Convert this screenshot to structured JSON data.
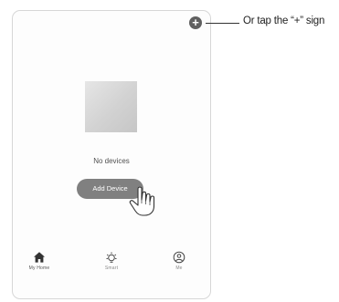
{
  "header": {
    "add_icon_glyph": "+"
  },
  "callout": {
    "text": "Or tap the “+” sign"
  },
  "main": {
    "empty_text": "No devices",
    "add_device_label": "Add Device"
  },
  "tabs": [
    {
      "label": "My Home",
      "icon": "home-icon",
      "active": true
    },
    {
      "label": "Smart",
      "icon": "smart-icon",
      "active": false
    },
    {
      "label": "Me",
      "icon": "profile-icon",
      "active": false
    }
  ],
  "colors": {
    "button": "#808080",
    "icon_dark": "#333333",
    "frame_border": "#d7d7d7"
  }
}
